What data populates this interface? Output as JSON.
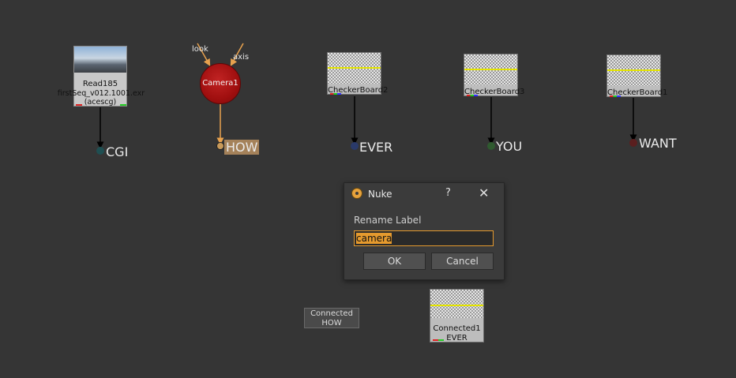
{
  "nodes": {
    "read": {
      "name": "Read185",
      "file": "firstSeq_v012.1001.exr",
      "colorspace": "(acescg)"
    },
    "camera": {
      "name": "Camera1",
      "inputs": [
        "look",
        "axis"
      ]
    },
    "checkerboards": [
      "CheckerBoard2",
      "CheckerBoard3",
      "CheckerBoard1"
    ],
    "dots": [
      "CGI",
      "HOW",
      "EVER",
      "YOU",
      "WANT"
    ],
    "connected_how": {
      "title": "Connected",
      "label": "HOW"
    },
    "connected_ever": {
      "title": "Connected1",
      "label": "EVER"
    }
  },
  "dialog": {
    "title": "Nuke",
    "help": "?",
    "close": "✕",
    "prompt": "Rename Label",
    "value": "camera",
    "ok_label": "OK",
    "cancel_label": "Cancel"
  },
  "colors": {
    "background": "#353535",
    "selection": "#e59a2e",
    "camera_node": "#a00f0f",
    "highlight_label": "#a5825a"
  }
}
